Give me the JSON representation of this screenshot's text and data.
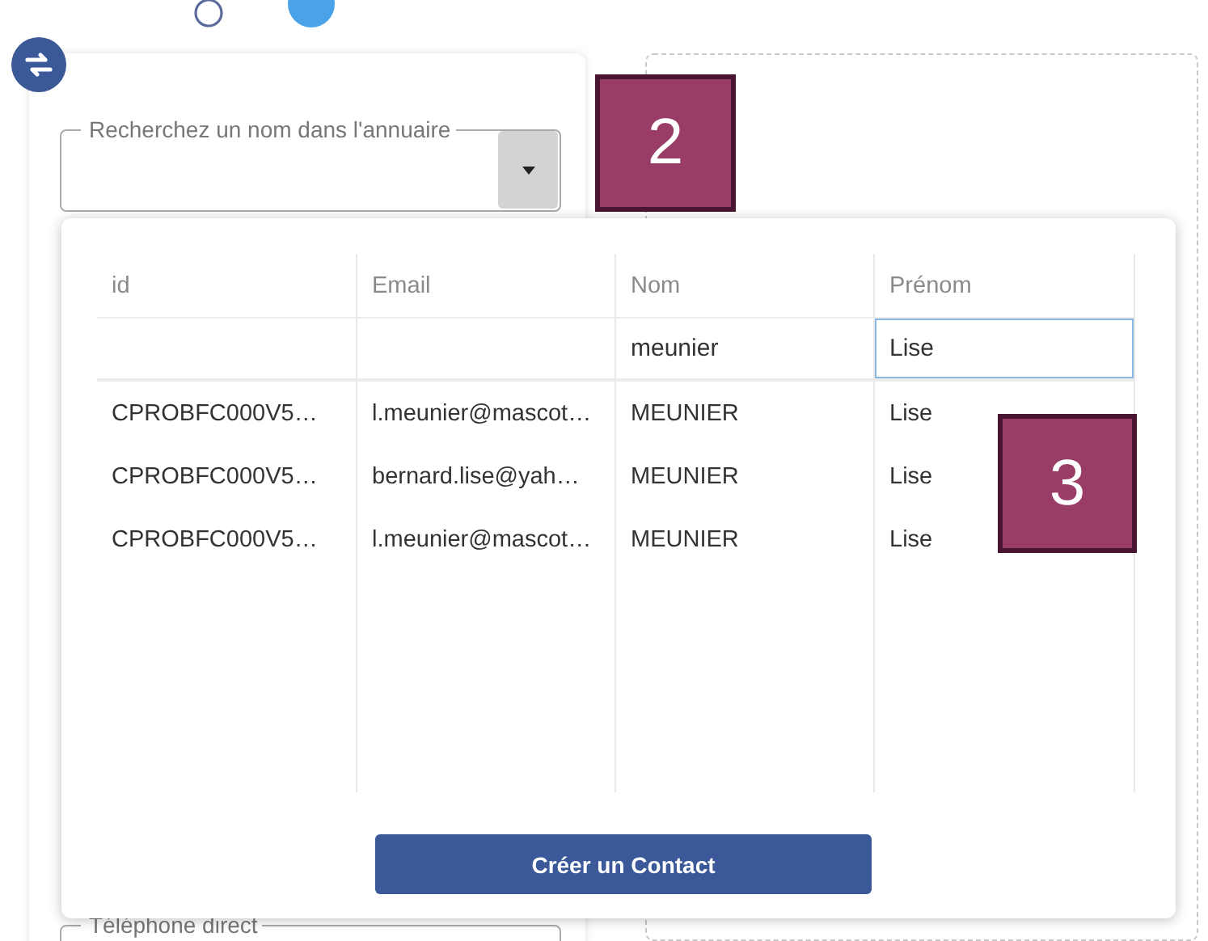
{
  "search_field": {
    "label": "Recherchez un nom dans l'annuaire"
  },
  "results_table": {
    "columns": [
      {
        "label": "id"
      },
      {
        "label": "Email"
      },
      {
        "label": "Nom",
        "filter": "meunier",
        "filter_focused": false
      },
      {
        "label": "Prénom",
        "filter": "Lise",
        "filter_focused": true
      }
    ],
    "rows": [
      [
        "CPROBFC000V5…",
        "l.meunier@mascot…",
        "MEUNIER",
        "Lise"
      ],
      [
        "CPROBFC000V5…",
        "bernard.lise@yah…",
        "MEUNIER",
        "Lise"
      ],
      [
        "CPROBFC000V5…",
        "l.meunier@mascot…",
        "MEUNIER",
        "Lise"
      ]
    ]
  },
  "create_button": "Créer un Contact",
  "phone_field": {
    "label": "Téléphone direct"
  },
  "badges": [
    {
      "label": "2"
    },
    {
      "label": "3"
    }
  ]
}
